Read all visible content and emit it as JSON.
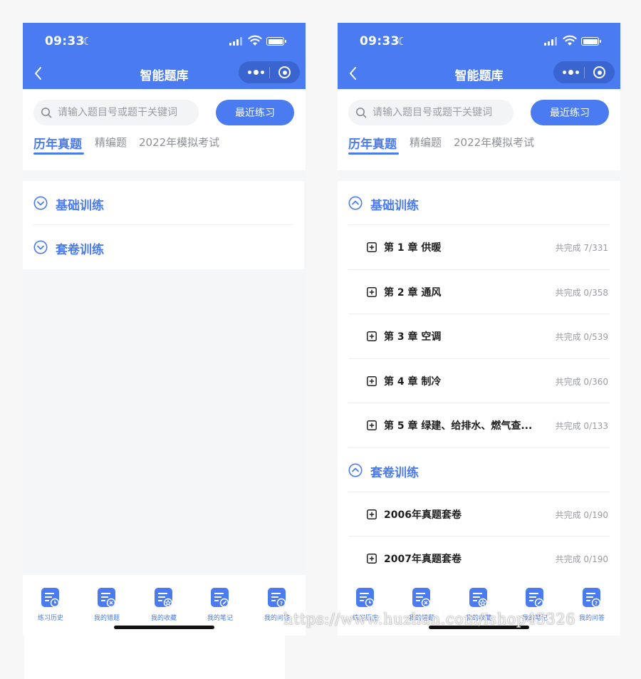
{
  "status": {
    "time": "09:33"
  },
  "nav": {
    "title": "智能题库"
  },
  "search": {
    "placeholder": "请输入题目号或题干关键词",
    "recent_label": "最近练习"
  },
  "tabs": [
    {
      "label": "历年真题",
      "active": true
    },
    {
      "label": "精编题",
      "active": false
    },
    {
      "label": "2022年模拟考试",
      "active": false
    }
  ],
  "sections": {
    "basic": {
      "title": "基础训练",
      "chapters": [
        {
          "title": "第 1 章 供暖",
          "progress": "共完成 7/331"
        },
        {
          "title": "第 2 章 通风",
          "progress": "共完成 0/358"
        },
        {
          "title": "第 3 章 空调",
          "progress": "共完成 0/539"
        },
        {
          "title": "第 4 章 制冷",
          "progress": "共完成 0/360"
        },
        {
          "title": "第 5 章 绿建、给排水、燃气查...",
          "progress": "共完成 0/133"
        }
      ]
    },
    "papers": {
      "title": "套卷训练",
      "items": [
        {
          "title": "2006年真题套卷",
          "progress": "共完成 0/190"
        },
        {
          "title": "2007年真题套卷",
          "progress": "共完成 0/190"
        }
      ]
    }
  },
  "tabbar": [
    {
      "label": "练习历史",
      "icon": "history-icon"
    },
    {
      "label": "我的错题",
      "icon": "wrong-questions-icon"
    },
    {
      "label": "我的收藏",
      "icon": "favorites-icon"
    },
    {
      "label": "我的笔记",
      "icon": "notes-icon"
    },
    {
      "label": "我的问答",
      "icon": "qa-icon"
    }
  ],
  "colors": {
    "brand": "#4a7bf0",
    "background": "#f5f6f7"
  },
  "watermark": "https://www.huzhan.com/ishop45326"
}
